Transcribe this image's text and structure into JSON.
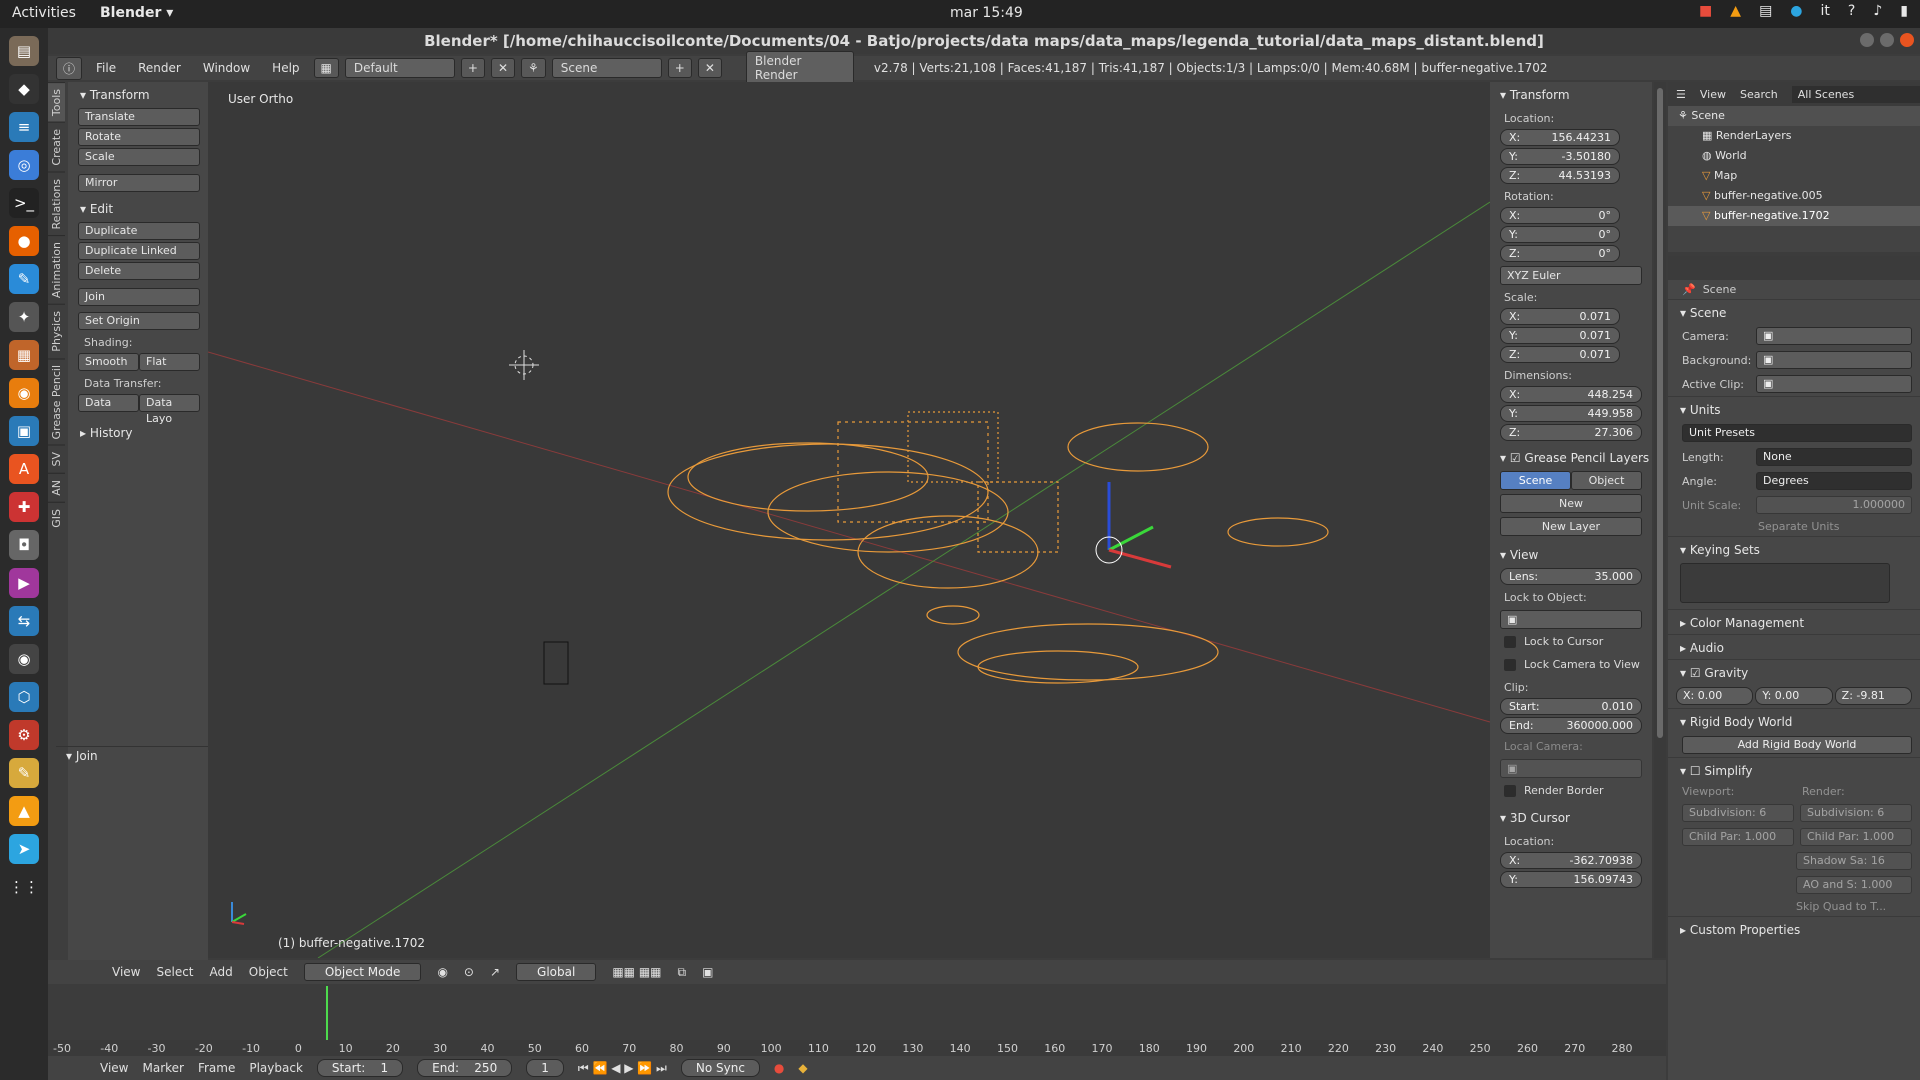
{
  "os": {
    "activities": "Activities",
    "app_menu": "Blender",
    "clock": "mar 15:49",
    "lang": "it"
  },
  "window": {
    "title": "Blender* [/home/chihauccisoilconte/Documents/04 - Batjo/projects/data maps/data_maps/legenda_tutorial/data_maps_distant.blend]"
  },
  "infobar": {
    "menus": [
      "File",
      "Render",
      "Window",
      "Help"
    ],
    "layout": "Default",
    "scene": "Scene",
    "engine": "Blender Render",
    "stats": "v2.78 | Verts:21,108 | Faces:41,187 | Tris:41,187 | Objects:1/3 | Lamps:0/0 | Mem:40.68M | buffer-negative.1702"
  },
  "toolshelf": {
    "tabs": [
      "Tools",
      "Create",
      "Relations",
      "Animation",
      "Physics",
      "Grease Pencil",
      "SV",
      "AN",
      "GIS"
    ],
    "transform_header": "Transform",
    "transform": [
      "Translate",
      "Rotate",
      "Scale",
      "Mirror"
    ],
    "edit_header": "Edit",
    "edit": [
      "Duplicate",
      "Duplicate Linked",
      "Delete",
      "Join"
    ],
    "set_origin": "Set Origin",
    "shading_label": "Shading:",
    "smooth": "Smooth",
    "flat": "Flat",
    "data_transfer_label": "Data Transfer:",
    "data": "Data",
    "data_layo": "Data Layo",
    "history": "History",
    "operator_header": "Join"
  },
  "viewport": {
    "view_label": "User Ortho",
    "object_label": "(1) buffer-negative.1702"
  },
  "npanel": {
    "transform": "Transform",
    "location": "Location:",
    "loc": [
      {
        "a": "X:",
        "v": "156.44231"
      },
      {
        "a": "Y:",
        "v": "-3.50180"
      },
      {
        "a": "Z:",
        "v": "44.53193"
      }
    ],
    "rotation": "Rotation:",
    "rot": [
      {
        "a": "X:",
        "v": "0°"
      },
      {
        "a": "Y:",
        "v": "0°"
      },
      {
        "a": "Z:",
        "v": "0°"
      }
    ],
    "rot_mode": "XYZ Euler",
    "scale": "Scale:",
    "scl": [
      {
        "a": "X:",
        "v": "0.071"
      },
      {
        "a": "Y:",
        "v": "0.071"
      },
      {
        "a": "Z:",
        "v": "0.071"
      }
    ],
    "dimensions": "Dimensions:",
    "dim": [
      {
        "a": "X:",
        "v": "448.254"
      },
      {
        "a": "Y:",
        "v": "449.958"
      },
      {
        "a": "Z:",
        "v": "27.306"
      }
    ],
    "gp_layers": "Grease Pencil Layers",
    "scene_tab": "Scene",
    "object_tab": "Object",
    "new": "New",
    "new_layer": "New Layer",
    "view": "View",
    "lens_label": "Lens:",
    "lens": "35.000",
    "lock_to_object": "Lock to Object:",
    "lock_to_cursor": "Lock to Cursor",
    "lock_cam": "Lock Camera to View",
    "clip": "Clip:",
    "clip_start_label": "Start:",
    "clip_start": "0.010",
    "clip_end_label": "End:",
    "clip_end": "360000.000",
    "local_camera": "Local Camera:",
    "render_border": "Render Border",
    "cursor": "3D Cursor",
    "cursor_location": "Location:",
    "cur": [
      {
        "a": "X:",
        "v": "-362.70938"
      },
      {
        "a": "Y:",
        "v": "156.09743"
      }
    ]
  },
  "outliner": {
    "menus": [
      "View",
      "Search"
    ],
    "filter": "All Scenes",
    "items": [
      "Scene",
      "RenderLayers",
      "World",
      "Map",
      "buffer-negative.005",
      "buffer-negative.1702"
    ]
  },
  "properties": {
    "context": "Scene",
    "scene_header": "Scene",
    "camera": "Camera:",
    "background": "Background:",
    "active_clip": "Active Clip:",
    "units": "Units",
    "unit_presets": "Unit Presets",
    "length_label": "Length:",
    "length": "None",
    "angle_label": "Angle:",
    "angle": "Degrees",
    "unit_scale_label": "Unit Scale:",
    "unit_scale": "1.000000",
    "separate_units": "Separate Units",
    "keying_sets": "Keying Sets",
    "color_mgmt": "Color Management",
    "audio": "Audio",
    "gravity": "Gravity",
    "gx": "X:  0.00",
    "gy": "Y:  0.00",
    "gz": "Z:  -9.81",
    "rigid": "Rigid Body World",
    "add_rigid": "Add Rigid Body World",
    "simplify": "Simplify",
    "viewport": "Viewport:",
    "render": "Render:",
    "subdiv_v": "Subdivision:  6",
    "subdiv_r": "Subdivision:  6",
    "childpar_v": "Child Par: 1.000",
    "childpar_r": "Child Par: 1.000",
    "shadow": "Shadow Sa:  16",
    "ao": "AO and S: 1.000",
    "skip_quad": "Skip Quad to T...",
    "custom_props": "Custom Properties"
  },
  "view_header": {
    "menus": [
      "View",
      "Select",
      "Add",
      "Object"
    ],
    "mode": "Object Mode",
    "orientation": "Global"
  },
  "timeline": {
    "ticks": [
      "-50",
      "-40",
      "-30",
      "-20",
      "-10",
      "0",
      "10",
      "20",
      "30",
      "40",
      "50",
      "60",
      "70",
      "80",
      "90",
      "100",
      "110",
      "120",
      "130",
      "140",
      "150",
      "160",
      "170",
      "180",
      "190",
      "200",
      "210",
      "220",
      "230",
      "240",
      "250",
      "260",
      "270",
      "280"
    ],
    "menus": [
      "View",
      "Marker",
      "Frame",
      "Playback"
    ],
    "start": "Start:",
    "start_v": "1",
    "end": "End:",
    "end_v": "250",
    "current": "1",
    "sync": "No Sync"
  }
}
